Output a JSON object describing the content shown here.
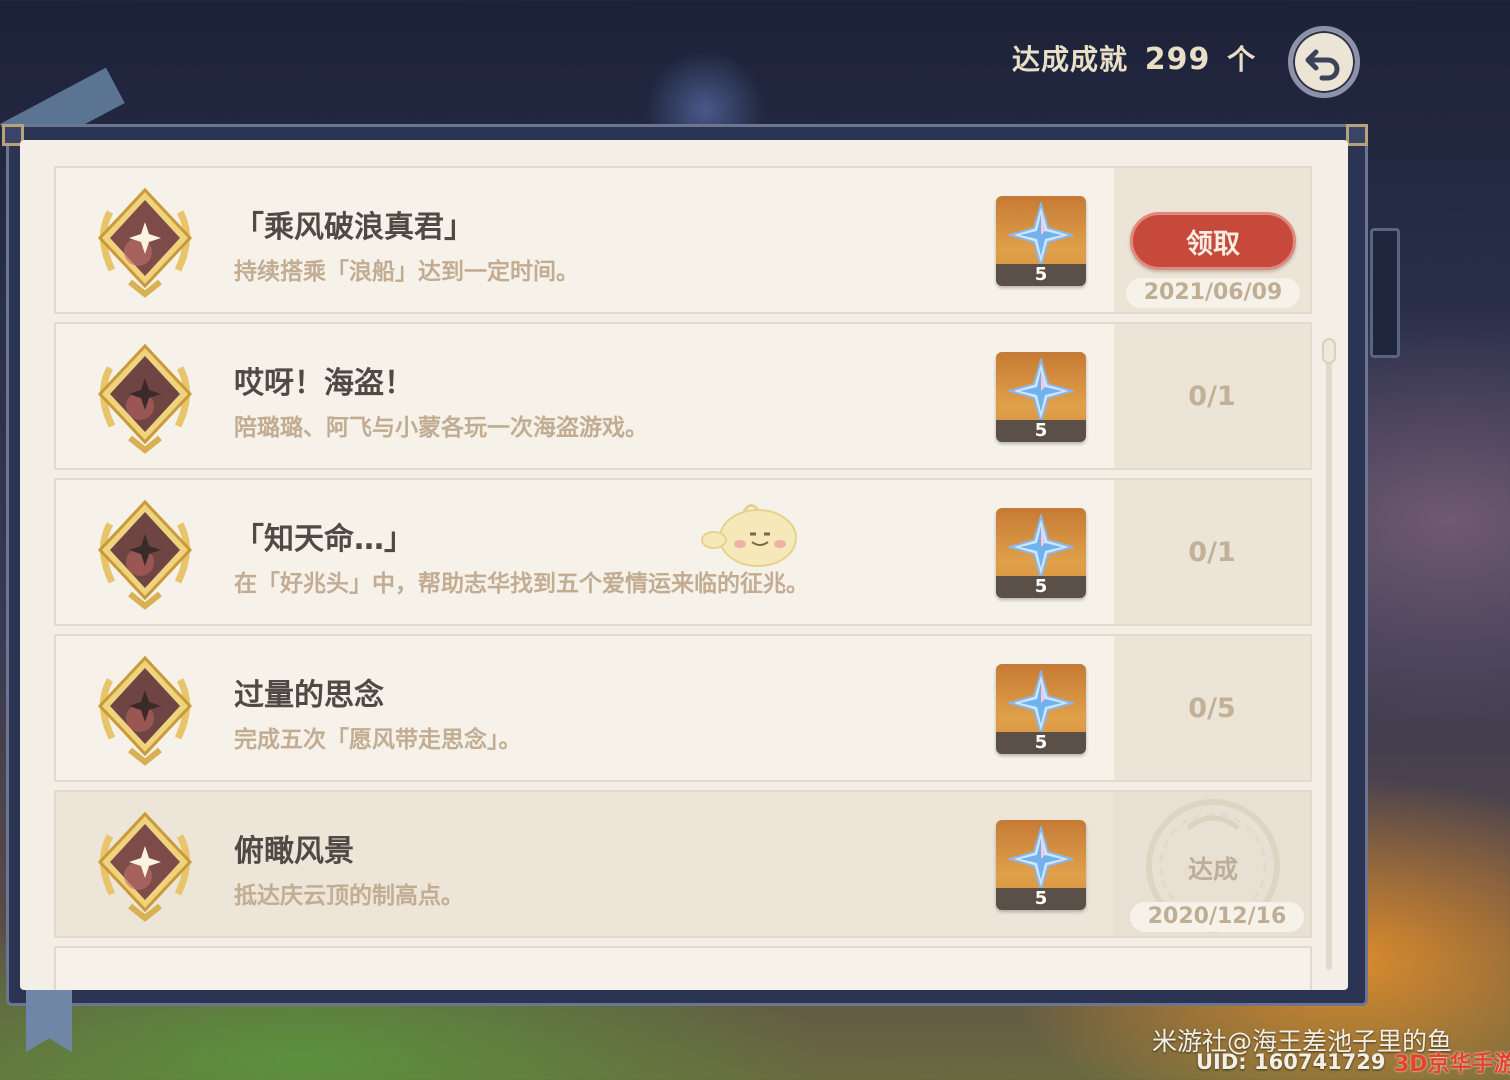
{
  "header": {
    "count_prefix": "达成成就",
    "count_value": "299",
    "count_suffix": "个"
  },
  "achievements": [
    {
      "title": "「乘风破浪真君」",
      "description": "持续搭乘「浪船」达到一定时间。",
      "reward_count": "5",
      "state": "claimable",
      "action_label": "领取",
      "date": "2021/06/09"
    },
    {
      "title": "哎呀！海盗！",
      "description": "陪璐璐、阿飞与小蒙各玩一次海盗游戏。",
      "reward_count": "5",
      "state": "in_progress",
      "progress": "0/1"
    },
    {
      "title": "「知天命…」",
      "description": "在「好兆头」中，帮助志华找到五个爱情运来临的征兆。",
      "reward_count": "5",
      "state": "in_progress",
      "progress": "0/1"
    },
    {
      "title": "过量的思念",
      "description": "完成五次「愿风带走思念」。",
      "reward_count": "5",
      "state": "in_progress",
      "progress": "0/5"
    },
    {
      "title": "俯瞰风景",
      "description": "抵达庆云顶的制高点。",
      "reward_count": "5",
      "state": "completed",
      "status_label": "达成",
      "date": "2020/12/16"
    }
  ],
  "watermark": {
    "author": "米游社@海王差池子里的鱼",
    "uid": "UID: 160741729",
    "site": "3D京华手游网"
  },
  "colors": {
    "claim_button": "#c6493c",
    "panel_bg": "#f4efe6",
    "frame": "#2b3452"
  }
}
